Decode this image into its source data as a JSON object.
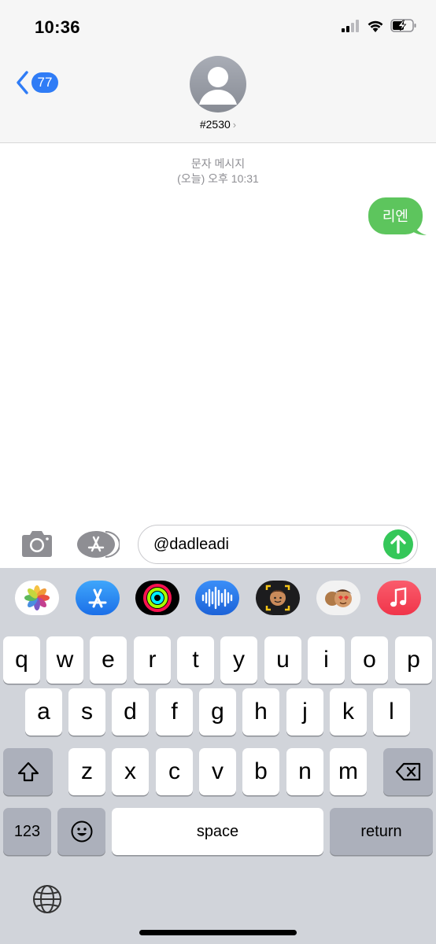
{
  "status_bar": {
    "time": "10:36",
    "signal_icon": "cellular-signal-icon",
    "wifi_icon": "wifi-icon",
    "battery_icon": "battery-charging-icon"
  },
  "header": {
    "back_icon": "chevron-left-icon",
    "unread_count": "77",
    "contact_name": "#2530",
    "contact_chevron": "›",
    "avatar_icon": "person-silhouette-icon"
  },
  "conversation": {
    "message_type": "문자 메시지",
    "timestamp": "(오늘) 오후 10:31",
    "messages": [
      {
        "text": "리엔",
        "direction": "outgoing",
        "color": "#5dc55d"
      }
    ]
  },
  "compose": {
    "camera_icon": "camera-icon",
    "apps_icon": "app-store-icon",
    "text_value": "@dadleadi",
    "send_icon": "arrow-up-icon",
    "send_color": "#35c759"
  },
  "app_strip": [
    {
      "name": "photos-app-icon"
    },
    {
      "name": "app-store-app-icon"
    },
    {
      "name": "activity-app-icon"
    },
    {
      "name": "audio-message-app-icon"
    },
    {
      "name": "memoji-app-icon"
    },
    {
      "name": "memoji-stickers-app-icon"
    },
    {
      "name": "music-app-icon"
    }
  ],
  "keyboard": {
    "row1": [
      "q",
      "w",
      "e",
      "r",
      "t",
      "y",
      "u",
      "i",
      "o",
      "p"
    ],
    "row2": [
      "a",
      "s",
      "d",
      "f",
      "g",
      "h",
      "j",
      "k",
      "l"
    ],
    "row3": [
      "z",
      "x",
      "c",
      "v",
      "b",
      "n",
      "m"
    ],
    "shift_icon": "shift-icon",
    "delete_icon": "delete-backspace-icon",
    "numbers_label": "123",
    "emoji_icon": "emoji-icon",
    "space_label": "space",
    "return_label": "return",
    "globe_icon": "globe-icon"
  }
}
